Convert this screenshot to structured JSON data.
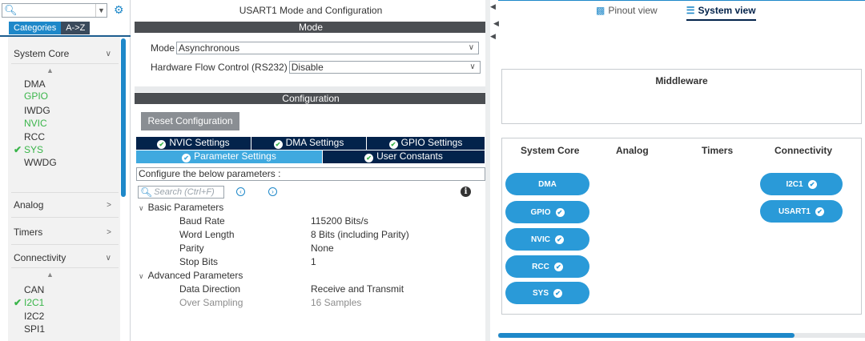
{
  "sidebar": {
    "search": {
      "value": "",
      "placeholder": ""
    },
    "tabs": [
      "Categories",
      "A->Z"
    ],
    "groups": {
      "system_core": {
        "label": "System Core",
        "items": [
          "DMA",
          "GPIO",
          "IWDG",
          "NVIC",
          "RCC",
          "SYS",
          "WWDG"
        ]
      },
      "analog": {
        "label": "Analog"
      },
      "timers": {
        "label": "Timers"
      },
      "connectivity": {
        "label": "Connectivity",
        "items": [
          "CAN",
          "I2C1",
          "I2C2",
          "SPI1"
        ]
      }
    }
  },
  "middle": {
    "title": "USART1 Mode and Configuration",
    "mode_header": "Mode",
    "mode": {
      "label": "Mode",
      "value": "Asynchronous"
    },
    "flow": {
      "label": "Hardware Flow Control (RS232)",
      "value": "Disable"
    },
    "config_header": "Configuration",
    "reset_button": "Reset Configuration",
    "tabs": [
      "NVIC Settings",
      "DMA Settings",
      "GPIO Settings",
      "Parameter Settings",
      "User Constants"
    ],
    "configure_text": "Configure the below parameters :",
    "search_placeholder": "Search (Ctrl+F)",
    "basic": {
      "label": "Basic Parameters",
      "rows": [
        {
          "name": "Baud Rate",
          "value": "115200 Bits/s"
        },
        {
          "name": "Word Length",
          "value": "8 Bits (including Parity)"
        },
        {
          "name": "Parity",
          "value": "None"
        },
        {
          "name": "Stop Bits",
          "value": "1"
        }
      ]
    },
    "advanced": {
      "label": "Advanced Parameters",
      "rows": [
        {
          "name": "Data Direction",
          "value": "Receive and Transmit"
        },
        {
          "name": "Over Sampling",
          "value": "16 Samples"
        }
      ]
    }
  },
  "right": {
    "view_tabs": [
      "Pinout view",
      "System view"
    ],
    "middleware": "Middleware",
    "columns": [
      "System Core",
      "Analog",
      "Timers",
      "Connectivity"
    ],
    "system_core_pills": [
      "DMA",
      "GPIO",
      "NVIC",
      "RCC",
      "SYS"
    ],
    "connectivity_pills": [
      "I2C1",
      "USART1"
    ]
  },
  "colors": {
    "accent": "#1e88c9",
    "navy": "#03234b",
    "enabled": "#3ab54a",
    "pill": "#2a9ad8"
  }
}
